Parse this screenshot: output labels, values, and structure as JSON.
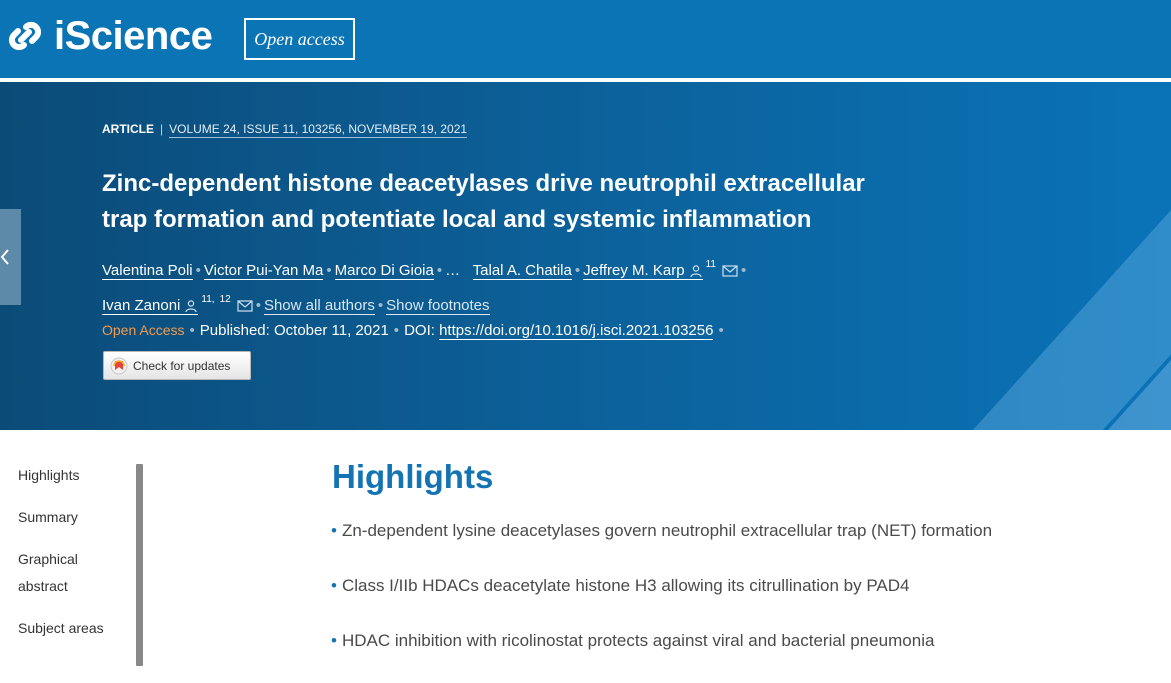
{
  "brand": {
    "name": "iScience",
    "badge": "Open access"
  },
  "article": {
    "type": "ARTICLE",
    "citation": "VOLUME 24, ISSUE 11, 103256, NOVEMBER 19, 2021",
    "title": "Zinc-dependent histone deacetylases drive neutrophil extracellular trap formation and potentiate local and systemic inflammation",
    "authors_line1": {
      "a1": "Valentina Poli",
      "a2": "Victor Pui-Yan Ma",
      "a3": "Marco Di Gioia",
      "ellipsis": "…",
      "a4": "Talal A. Chatila",
      "a5": "Jeffrey M. Karp",
      "a5_sup": "11"
    },
    "authors_line2": {
      "a6": "Ivan Zanoni",
      "a6_sup": "11,",
      "a6_sup2": "12",
      "show_all": "Show all authors",
      "show_footnotes": "Show footnotes"
    },
    "access": "Open Access",
    "published": "Published: October 11, 2021",
    "doi_label": "DOI:",
    "doi": "https://doi.org/10.1016/j.isci.2021.103256",
    "check_updates": "Check for updates"
  },
  "nav": {
    "highlights": "Highlights",
    "summary": "Summary",
    "graphical_1": "Graphical",
    "graphical_2": "abstract",
    "subject_areas": "Subject areas"
  },
  "highlights": {
    "heading": "Highlights",
    "bullet": "•",
    "items": [
      "Zn-dependent lysine deacetylases govern neutrophil extracellular trap (NET) formation",
      "Class I/IIb HDACs deacetylate histone H3 allowing its citrullination by PAD4",
      "HDAC inhibition with ricolinostat protects against viral and bacterial pneumonia"
    ]
  },
  "colors": {
    "brand_blue": "#0b74b5",
    "heading_blue": "#1473b3",
    "open_access_orange": "#f49a4a"
  },
  "icons": {
    "person": "person-icon",
    "mail": "mail-icon",
    "chevron": "chevron-left-icon"
  }
}
